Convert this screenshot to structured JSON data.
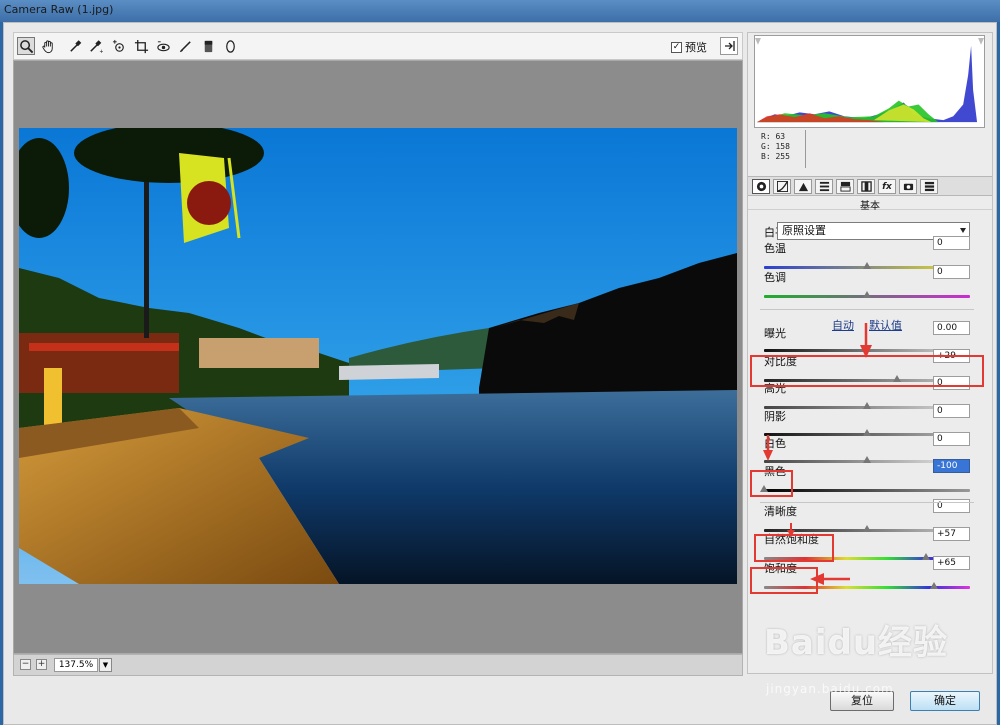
{
  "window": {
    "title": "Camera Raw (1.jpg)"
  },
  "toolbar": {
    "tools": [
      "zoom-tool",
      "hand-tool",
      "white-balance-tool",
      "color-sampler-tool",
      "targeted-adjustment-tool",
      "crop-tool",
      "straighten-tool",
      "spot-removal-tool",
      "red-eye-tool",
      "adjustment-brush-tool",
      "graduated-filter-tool",
      "radial-filter-tool"
    ],
    "preview_label": "预览",
    "preview_checked": true
  },
  "status": {
    "zoom": "137.5%",
    "zoom_out": "−",
    "zoom_in": "+"
  },
  "readout": {
    "r": "R:  63",
    "g": "G:  158",
    "b": "B:  255"
  },
  "panel": {
    "section_title": "基本",
    "white_balance_label": "白平衡:",
    "white_balance_value": "原照设置",
    "auto_link": "自动",
    "default_link": "默认值",
    "sliders": [
      {
        "key": "temperature",
        "label": "色温",
        "value": "0",
        "level": 0.5
      },
      {
        "key": "tint",
        "label": "色调",
        "value": "0",
        "level": 0.5
      },
      {
        "key": "exposure",
        "label": "曝光",
        "value": "0.00",
        "level": 0.5
      },
      {
        "key": "contrast",
        "label": "对比度",
        "value": "+29",
        "level": 0.645
      },
      {
        "key": "highlights",
        "label": "高光",
        "value": "0",
        "level": 0.5
      },
      {
        "key": "shadows",
        "label": "阴影",
        "value": "0",
        "level": 0.5
      },
      {
        "key": "whites",
        "label": "白色",
        "value": "0",
        "level": 0.5
      },
      {
        "key": "blacks",
        "label": "黑色",
        "value": "-100",
        "level": 0.0
      },
      {
        "key": "clarity",
        "label": "清晰度",
        "value": "0",
        "level": 0.5
      },
      {
        "key": "vibrance",
        "label": "自然饱和度",
        "value": "+57",
        "level": 0.785
      },
      {
        "key": "saturation",
        "label": "饱和度",
        "value": "+65",
        "level": 0.825
      }
    ]
  },
  "buttons": {
    "reset": "复位",
    "ok": "确定"
  },
  "colors": {
    "highlight": "#e23a33",
    "link": "#1f3c8a",
    "selected": "#3875d7"
  },
  "watermark": {
    "brand": "Baidu经验",
    "url": "jingyan.baidu.com"
  }
}
